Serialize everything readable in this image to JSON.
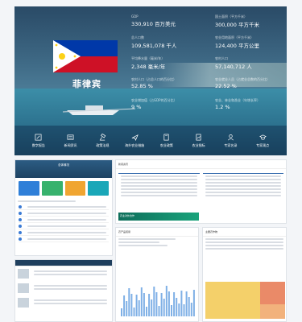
{
  "country": "菲律宾",
  "stats": [
    {
      "label": "GDP",
      "value": "330,910 百万美元"
    },
    {
      "label": "国土面积（平方千米）",
      "value": "300,000 平方千米"
    },
    {
      "label": "总人口数",
      "value": "109,581,078 千人"
    },
    {
      "label": "农业用地面积（平方千米）",
      "value": "124,400 平方公里"
    },
    {
      "label": "平均降水量（毫米/年）",
      "value": "2,348 毫米/年"
    },
    {
      "label": "农村人口",
      "value": "57,140,712 人"
    },
    {
      "label": "农村人口（占总人口的百分比）",
      "value": "52.85 %"
    },
    {
      "label": "农业就业人员（占就业总数的百分比）",
      "value": "22.52 %"
    },
    {
      "label": "农业增加值（占GDP的百分比）",
      "value": "9 %"
    },
    {
      "label": "农业、林业和渔业（年增长率）",
      "value": "1.2 %"
    }
  ],
  "nav": [
    {
      "label": "数字报告",
      "icon": "edit-icon"
    },
    {
      "label": "新闻资讯",
      "icon": "news-icon"
    },
    {
      "label": "政策法规",
      "icon": "gavel-icon"
    },
    {
      "label": "海外农业措施",
      "icon": "plane-icon"
    },
    {
      "label": "农业政策",
      "icon": "book-icon"
    },
    {
      "label": "农业指标",
      "icon": "chart-icon"
    },
    {
      "label": "专家名录",
      "icon": "expert-icon"
    },
    {
      "label": "专家观点",
      "icon": "cap-icon"
    }
  ],
  "thumbs": {
    "dashboard_title": "总体情况",
    "news_title": "新闻资讯",
    "promo_text": "农业对外合作",
    "chart_title": "农产品贸易",
    "treemap_title": "主要农作物"
  },
  "colors": {
    "flag_blue": "#0038a8",
    "flag_red": "#ce1126",
    "flag_sun": "#fcd116"
  }
}
